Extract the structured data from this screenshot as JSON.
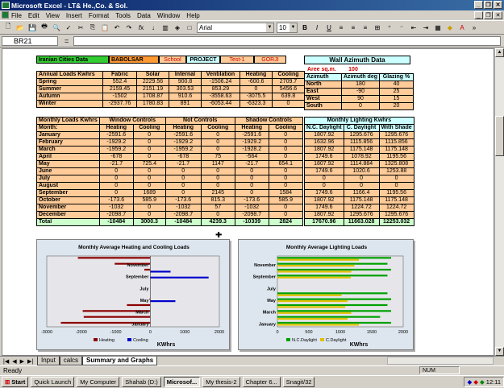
{
  "window": {
    "title": "Microsoft Excel - LT& He.,Co. & Sol.",
    "min": "_",
    "max": "❐",
    "close": "✕"
  },
  "menu": [
    "File",
    "Edit",
    "View",
    "Insert",
    "Format",
    "Tools",
    "Data",
    "Window",
    "Help"
  ],
  "toolbar": {
    "font": "Arial",
    "size": "10",
    "bold": "B",
    "italic": "I",
    "underline": "U"
  },
  "formula_bar": {
    "cell_ref": "BR21",
    "fx": "=",
    "formula": ""
  },
  "top_row": {
    "name": "Iranian Cities Data",
    "city": "BABOLSAR",
    "school": "School",
    "project": "PROJECT",
    "test": "Test-1",
    "gorji": "GORJI"
  },
  "annual": {
    "headers": [
      "Annual Loads  Kwhrs",
      "Fabric",
      "Solar",
      "Internal",
      "Ventilation",
      "Heating",
      "Cooling"
    ],
    "rows": [
      [
        "Spring",
        "552.4",
        "2229.56",
        "900.8",
        "-1506.24",
        "-600.6",
        "2709.7"
      ],
      [
        "Summer",
        "2159.45",
        "2151.19",
        "303.53",
        "853.29",
        "0",
        "5456.6"
      ],
      [
        "Autumn",
        "-1502",
        "1708.87",
        "910.6",
        "-3558.63",
        "-3075.5",
        "639.8"
      ],
      [
        "Winter",
        "-2937.76",
        "1780.83",
        "891",
        "-6053.44",
        "-6323.3",
        "0"
      ]
    ]
  },
  "wall": {
    "title": "Wall Azimuth Data",
    "area_label": "Aree sq.m.",
    "area_value": "100",
    "headers": [
      "Azimuth",
      "Azimuth deg",
      "Glazing %"
    ],
    "rows": [
      [
        "North",
        "180",
        "40"
      ],
      [
        "East",
        "-90",
        "25"
      ],
      [
        "West",
        "90",
        "15"
      ],
      [
        "South",
        "0",
        "20"
      ]
    ]
  },
  "monthly": {
    "group_headers": [
      "Monthly Loads  Kwhrs",
      "Window  Controls",
      "Not  Controls",
      "Shadow Controls"
    ],
    "sub_headers": [
      "Month:",
      "Heating",
      "Cooling",
      "Heating",
      "Cooling",
      "Heating",
      "Cooling"
    ],
    "rows": [
      [
        "January",
        "-2591.6",
        "0",
        "-2591.6",
        "0",
        "-2591.6",
        "0"
      ],
      [
        "February",
        "-1929.2",
        "0",
        "-1929.2",
        "0",
        "-1929.2",
        "0"
      ],
      [
        "March",
        "-1959.2",
        "0",
        "-1959.2",
        "0",
        "-1928.2",
        "0"
      ],
      [
        "April",
        "-678",
        "0",
        "-678",
        "75",
        "-564",
        "0"
      ],
      [
        "May",
        "-21.7",
        "725.4",
        "-21.7",
        "1147",
        "-21.7",
        "654.1"
      ],
      [
        "June",
        "0",
        "0",
        "0",
        "0",
        "0",
        "0"
      ],
      [
        "July",
        "0",
        "0",
        "0",
        "0",
        "0",
        "0"
      ],
      [
        "August",
        "0",
        "0",
        "0",
        "0",
        "0",
        "0"
      ],
      [
        "September",
        "0",
        "1689",
        "0",
        "2145",
        "0",
        "1584"
      ],
      [
        "October",
        "-173.6",
        "585.9",
        "-173.6",
        "815.3",
        "-173.6",
        "585.9"
      ],
      [
        "November",
        "-1032",
        "0",
        "-1032",
        "57",
        "-1032",
        "0"
      ],
      [
        "December",
        "-2098.7",
        "0",
        "-2098.7",
        "0",
        "-2098.7",
        "0"
      ]
    ],
    "total": [
      "Total",
      "-10484",
      "3000.3",
      "-10484",
      "4239.3",
      "-10339",
      "2824"
    ]
  },
  "lighting": {
    "title": "Monthly Lighting  Kwhrs",
    "headers": [
      "N.C. Daylight",
      "C. Daylight",
      "With Shade"
    ],
    "rows": [
      [
        "1807.92",
        "1295.676",
        "1295.676"
      ],
      [
        "1632.96",
        "1115.856",
        "1115.856"
      ],
      [
        "1807.92",
        "1175.148",
        "1175.148"
      ],
      [
        "1749.6",
        "1078.92",
        "1195.56"
      ],
      [
        "1807.92",
        "1114.884",
        "1325.808"
      ],
      [
        "1749.6",
        "1020.6",
        "1253.88"
      ],
      [
        "0",
        "0",
        "0"
      ],
      [
        "0",
        "0",
        "0"
      ],
      [
        "1749.6",
        "1166.4",
        "1195.56"
      ],
      [
        "1807.92",
        "1175.148",
        "1175.148"
      ],
      [
        "1749.6",
        "1224.72",
        "1224.72"
      ],
      [
        "1807.92",
        "1295.676",
        "1295.676"
      ]
    ],
    "total": [
      "17670.96",
      "11663.028",
      "12253.032"
    ]
  },
  "chart_data": [
    {
      "type": "bar",
      "title": "Monthly Average Heating and Cooling Loads",
      "xlabel": "KWhrs",
      "xlim": [
        -3000,
        2000
      ],
      "xticks": [
        "-3000",
        "-2000",
        "-1000",
        "0",
        "1000",
        "2000"
      ],
      "labeled_categories": [
        "November",
        "September",
        "July",
        "May",
        "March",
        "January"
      ],
      "categories": [
        "January",
        "February",
        "March",
        "April",
        "May",
        "June",
        "July",
        "August",
        "September",
        "October",
        "November",
        "December"
      ],
      "series": [
        {
          "name": "Heating",
          "color": "#8b0000",
          "values": [
            -2591.6,
            -1929.2,
            -1959.2,
            -678,
            -21.7,
            0,
            0,
            0,
            0,
            -173.6,
            -1032,
            -2098.7
          ]
        },
        {
          "name": "Cooling",
          "color": "#0000cc",
          "values": [
            0,
            0,
            0,
            0,
            725.4,
            0,
            0,
            0,
            1689,
            585.9,
            0,
            0
          ]
        }
      ],
      "legend": "bottom"
    },
    {
      "type": "bar",
      "title": "Monthly Average Lighting Loads",
      "xlabel": "KWhrs",
      "xlim": [
        0,
        2000
      ],
      "xticks": [
        "0",
        "500",
        "1000",
        "1500",
        "2000"
      ],
      "labeled_categories": [
        "November",
        "September",
        "July",
        "May",
        "March",
        "January"
      ],
      "categories": [
        "January",
        "February",
        "March",
        "April",
        "May",
        "June",
        "July",
        "August",
        "September",
        "October",
        "November",
        "December"
      ],
      "series": [
        {
          "name": "N.C.Daylight",
          "color": "#00a000",
          "values": [
            1807.92,
            1632.96,
            1807.92,
            1749.6,
            1807.92,
            1749.6,
            0,
            0,
            1749.6,
            1807.92,
            1749.6,
            1807.92
          ]
        },
        {
          "name": "C.Daylight",
          "color": "#e0c000",
          "values": [
            1295.676,
            1115.856,
            1175.148,
            1078.92,
            1114.884,
            1020.6,
            0,
            0,
            1166.4,
            1175.148,
            1224.72,
            1295.676
          ]
        }
      ],
      "legend": "bottom"
    }
  ],
  "sheets": [
    "Input",
    "calcs",
    "Summary and Graphs"
  ],
  "status": {
    "text": "Ready",
    "num": "NUM"
  },
  "taskbar": {
    "start": "Start",
    "quick": "Quick Launch",
    "items": [
      "My Computer",
      "Shahab (D:)",
      "Microsof...",
      "My thesis-2",
      "Chapter 6...",
      "Snagit/32"
    ],
    "clock": "12:11"
  }
}
